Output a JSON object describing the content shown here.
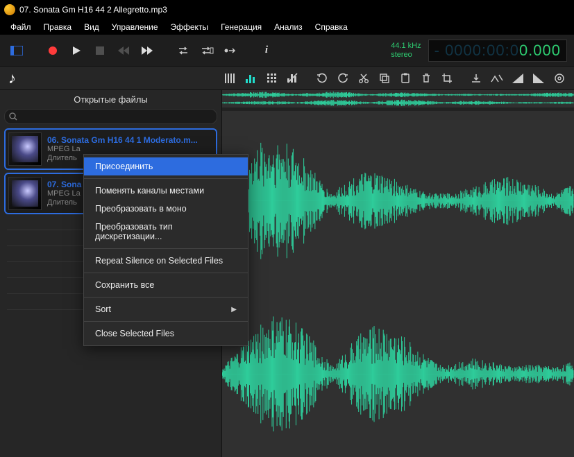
{
  "title": "07. Sonata Gm H16 44 2 Allegretto.mp3",
  "menu": {
    "items": [
      "Файл",
      "Правка",
      "Вид",
      "Управление",
      "Эффекты",
      "Генерация",
      "Анализ",
      "Справка"
    ]
  },
  "readout": {
    "rate": "44.1 kHz",
    "mode": "stereo",
    "dim": "- 0000:00:0",
    "lit": "0.000"
  },
  "sidebar": {
    "title": "Открытые файлы",
    "search_placeholder": "",
    "files": [
      {
        "name": "06. Sonata Gm H16 44 1 Moderato.m...",
        "codec": "MPEG La",
        "dur": "Длитель"
      },
      {
        "name": "07. Sona",
        "codec": "MPEG La",
        "dur": "Длитель"
      }
    ]
  },
  "context": {
    "items": [
      {
        "label": "Присоединить",
        "hl": true
      },
      {
        "sep": true
      },
      {
        "label": "Поменять каналы местами"
      },
      {
        "label": "Преобразовать в моно"
      },
      {
        "label": "Преобразовать тип дискретизации..."
      },
      {
        "sep": true
      },
      {
        "label": "Repeat Silence on Selected Files"
      },
      {
        "sep": true
      },
      {
        "label": "Сохранить все"
      },
      {
        "sep": true
      },
      {
        "label": "Sort",
        "sub": true
      },
      {
        "sep": true
      },
      {
        "label": "Close Selected Files"
      }
    ]
  },
  "colors": {
    "accent": "#2d6cdf",
    "wave": "#2ecc9a",
    "record": "#ff3b3b"
  }
}
